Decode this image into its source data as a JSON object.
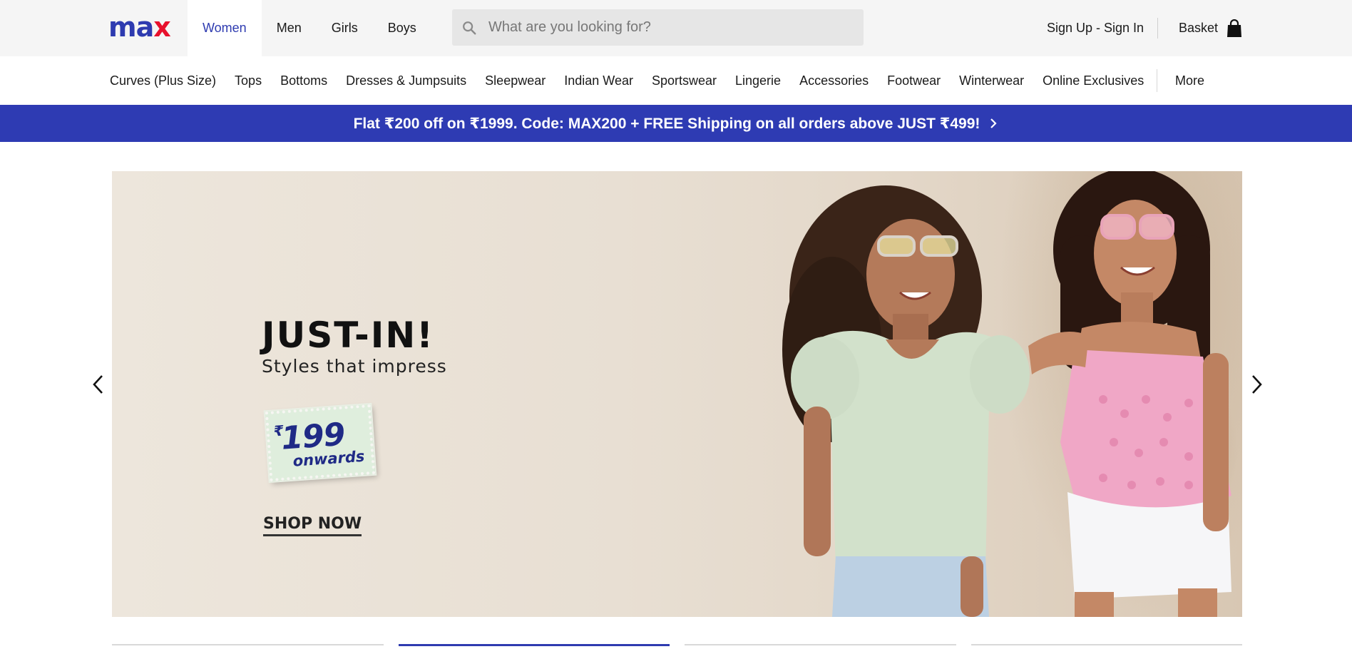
{
  "brand": {
    "logo_part1": "ma",
    "logo_part2": "x"
  },
  "departments": [
    {
      "label": "Women",
      "active": true
    },
    {
      "label": "Men",
      "active": false
    },
    {
      "label": "Girls",
      "active": false
    },
    {
      "label": "Boys",
      "active": false
    }
  ],
  "search": {
    "placeholder": "What are you looking for?",
    "value": ""
  },
  "account": {
    "label": "Sign Up - Sign In"
  },
  "basket": {
    "label": "Basket"
  },
  "categories": [
    "Curves (Plus Size)",
    "Tops",
    "Bottoms",
    "Dresses & Jumpsuits",
    "Sleepwear",
    "Indian Wear",
    "Sportswear",
    "Lingerie",
    "Accessories",
    "Footwear",
    "Winterwear",
    "Online Exclusives"
  ],
  "more_label": "More",
  "promo": {
    "text": "Flat ₹200 off on ₹1999. Code: MAX200 + FREE Shipping on all orders above JUST ₹499!"
  },
  "hero": {
    "title": "JUST-IN!",
    "subtitle": "Styles that impress",
    "price_symbol": "₹",
    "price": "199",
    "price_note": "onwards",
    "cta": "SHOP NOW"
  },
  "carousel": {
    "slide_count": 4,
    "active_index": 1
  },
  "colors": {
    "brand_blue": "#2e3bb0",
    "brand_red": "#e8112d",
    "promo_bg": "#2e3bb3"
  },
  "icons": {
    "search": "search-icon",
    "basket": "shopping-bag-icon",
    "promo_arrow": "chevron-right-icon",
    "prev": "chevron-left-icon",
    "next": "chevron-right-icon"
  }
}
